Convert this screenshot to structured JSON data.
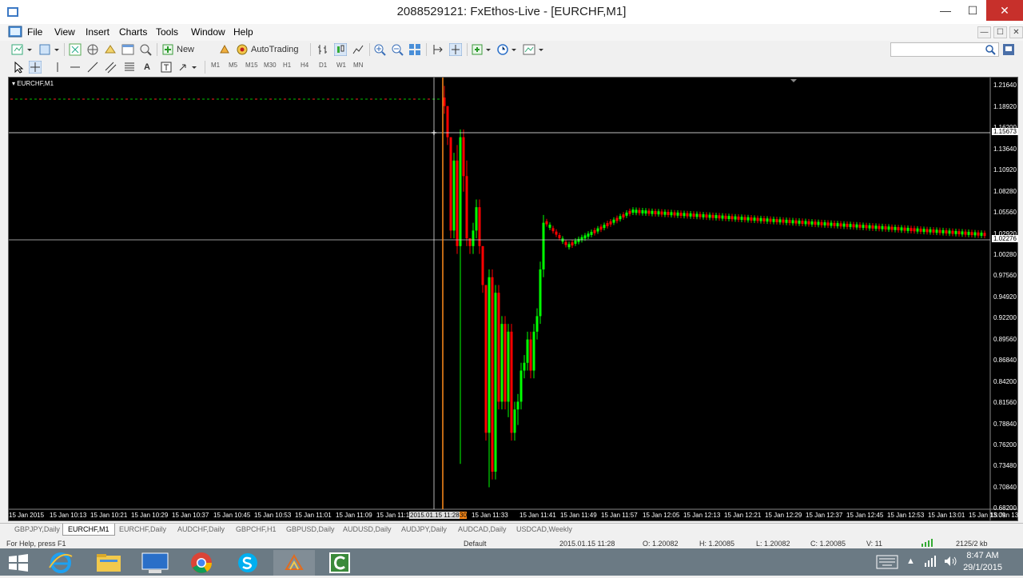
{
  "window": {
    "title": "2088529121: FxEthos-Live - [EURCHF,M1]",
    "minimize_glyph": "—",
    "maximize_glyph": "☐",
    "close_glyph": "✕"
  },
  "menu": [
    "File",
    "View",
    "Insert",
    "Charts",
    "Tools",
    "Window",
    "Help"
  ],
  "toolbar": {
    "new_order_label": "New Order",
    "autotrading_label": "AutoTrading",
    "timeframes": [
      "M1",
      "M5",
      "M15",
      "M30",
      "H1",
      "H4",
      "D1",
      "W1",
      "MN"
    ],
    "line_tool_label": "A"
  },
  "chart": {
    "symbol_label": "EURCHF,M1",
    "price_labels": [
      "1.21640",
      "1.18920",
      "1.16200",
      "1.13640",
      "1.10920",
      "1.08280",
      "1.05560",
      "1.02920",
      "1.00280",
      "0.97560",
      "0.94920",
      "0.92200",
      "0.89560",
      "0.86840",
      "0.84200",
      "0.81560",
      "0.78840",
      "0.76200",
      "0.73480",
      "0.70840",
      "0.68200"
    ],
    "current_price_top": "1.15673",
    "current_price_bottom": "1.02276",
    "time_labels": [
      "15 Jan 2015",
      "15 Jan 10:13",
      "15 Jan 10:21",
      "15 Jan 10:29",
      "15 Jan 10:37",
      "15 Jan 10:45",
      "15 Jan 10:53",
      "15 Jan 11:01",
      "15 Jan 11:09",
      "15 Jan 11:17",
      "15 Jan 11:33",
      "15 Jan 11:41",
      "15 Jan 11:49",
      "15 Jan 11:57",
      "15 Jan 12:05",
      "15 Jan 12:13",
      "15 Jan 12:21",
      "15 Jan 12:29",
      "15 Jan 12:37",
      "15 Jan 12:45",
      "15 Jan 12:53",
      "15 Jan 13:01",
      "15 Jan 13:09",
      "15 Jan 13"
    ],
    "crosshair_time": "2015.01.15 11:28",
    "crosshair_time_tail": "30",
    "colors": {
      "bull": "#00ff00",
      "bear": "#ff0000",
      "crosshair": "#ffffff",
      "vline": "#ff8c1a"
    }
  },
  "chart_tabs": [
    "GBPJPY,Daily",
    "EURCHF,M1",
    "EURCHF,Daily",
    "AUDCHF,Daily",
    "GBPCHF,H1",
    "GBPUSD,Daily",
    "AUDUSD,Daily",
    "AUDJPY,Daily",
    "AUDCAD,Daily",
    "USDCAD,Weekly"
  ],
  "status": {
    "help": "For Help, press F1",
    "profile": "Default",
    "datetime": "2015.01.15 11:28",
    "open": "O: 1.20082",
    "high": "H: 1.20085",
    "low": "L: 1.20082",
    "close": "C: 1.20085",
    "volume": "V: 11",
    "traffic": "2125/2 kb"
  },
  "taskbar": {
    "time": "8:47 AM",
    "date": "29/1/2015"
  }
}
